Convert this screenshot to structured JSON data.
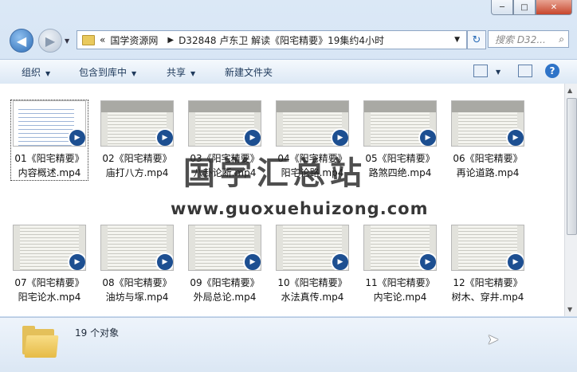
{
  "window": {
    "min_label": "─",
    "max_label": "□",
    "close_label": "✕"
  },
  "address": {
    "crumbs": [
      "«",
      "国学资源网",
      "D32848 卢东卫 解读《阳宅精要》19集约4小时"
    ],
    "search_placeholder": "搜索 D32..."
  },
  "toolbar": {
    "organize": "组织",
    "include_library": "包含到库中",
    "share": "共享",
    "new_folder": "新建文件夹"
  },
  "files": [
    {
      "line1": "01《阳宅精要》",
      "line2": "内容概述.mp4"
    },
    {
      "line1": "02《阳宅精要》",
      "line2": "庙打八方.mp4"
    },
    {
      "line1": "03《阳宅精要》",
      "line2": "八卦论断.mp4"
    },
    {
      "line1": "04《阳宅精要》",
      "line2": "阳宅论路.mp4"
    },
    {
      "line1": "05《阳宅精要》",
      "line2": "路煞四绝.mp4"
    },
    {
      "line1": "06《阳宅精要》",
      "line2": "再论道路.mp4"
    },
    {
      "line1": "07《阳宅精要》",
      "line2": "阳宅论水.mp4"
    },
    {
      "line1": "08《阳宅精要》",
      "line2": "油坊与塚.mp4"
    },
    {
      "line1": "09《阳宅精要》",
      "line2": "外局总论.mp4"
    },
    {
      "line1": "10《阳宅精要》",
      "line2": "水法真传.mp4"
    },
    {
      "line1": "11《阳宅精要》",
      "line2": "内宅论.mp4"
    },
    {
      "line1": "12《阳宅精要》",
      "line2": "树木、穿井.mp4"
    }
  ],
  "watermark": {
    "title": "国学汇总站",
    "url": "www.guoxuehuizong.com"
  },
  "status": {
    "count": "19 个对象"
  }
}
